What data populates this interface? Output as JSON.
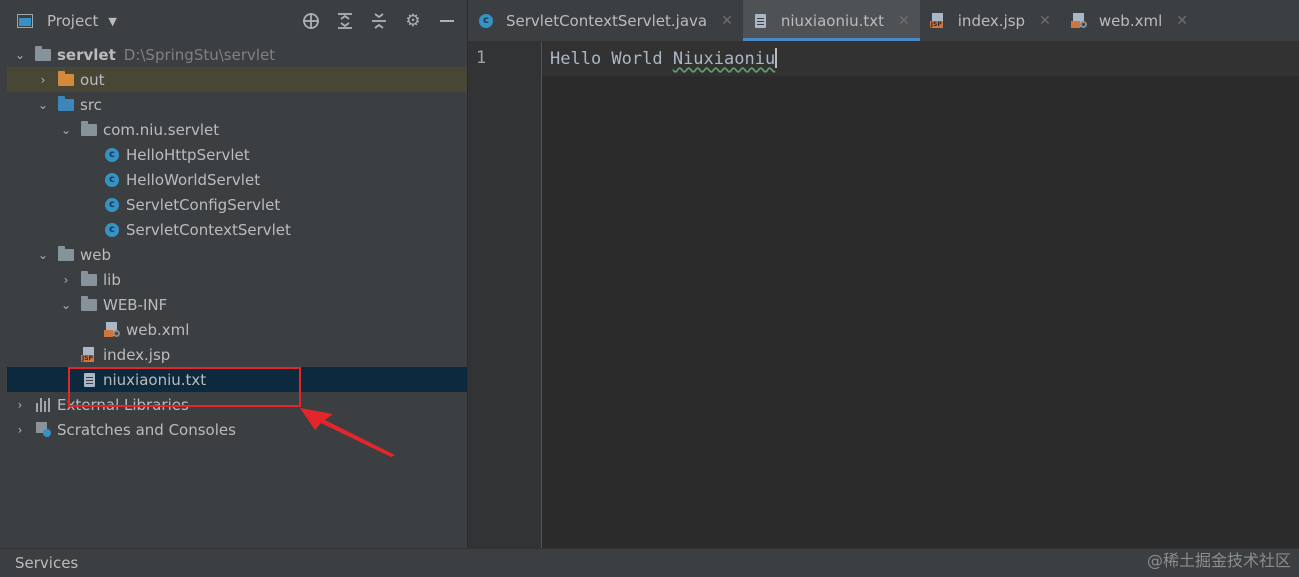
{
  "project_panel": {
    "title": "Project"
  },
  "tree": {
    "root": {
      "label": "servlet",
      "path": "D:\\SpringStu\\servlet"
    },
    "out": "out",
    "src": "src",
    "package": "com.niu.servlet",
    "classes": [
      "HelloHttpServlet",
      "HelloWorldServlet",
      "ServletConfigServlet",
      "ServletContextServlet"
    ],
    "web": "web",
    "lib": "lib",
    "webinf": "WEB-INF",
    "webxml": "web.xml",
    "indexjsp": "index.jsp",
    "selected_file": "niuxiaoniu.txt",
    "external_libraries": "External Libraries",
    "scratches": "Scratches and Consoles"
  },
  "tabs": [
    {
      "label": "ServletContextServlet.java",
      "active": false
    },
    {
      "label": "niuxiaoniu.txt",
      "active": true
    },
    {
      "label": "index.jsp",
      "active": false
    },
    {
      "label": "web.xml",
      "active": false
    }
  ],
  "editor": {
    "line_number": "1",
    "text_plain": "Hello World ",
    "text_flagged": "Niuxiaoniu"
  },
  "statusbar": {
    "services": "Services"
  },
  "watermark": "@稀土掘金技术社区",
  "colors": {
    "annotation": "#e3262b",
    "selection": "#0d293e",
    "active_tab_underline": "#4a88c7"
  }
}
